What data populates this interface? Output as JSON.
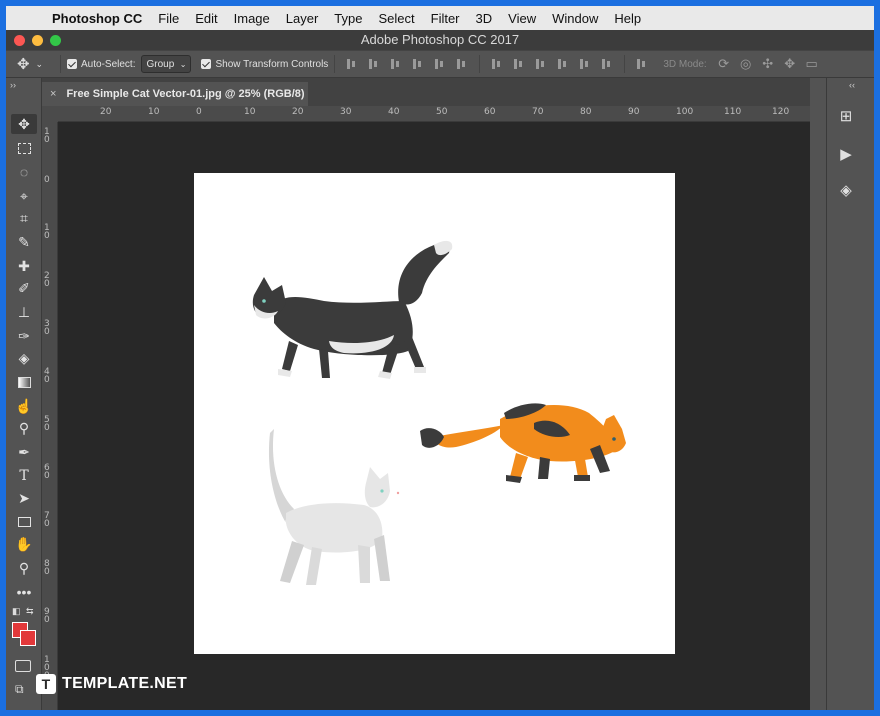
{
  "menubar": {
    "app_name": "Photoshop CC",
    "items": [
      "File",
      "Edit",
      "Image",
      "Layer",
      "Type",
      "Select",
      "Filter",
      "3D",
      "View",
      "Window",
      "Help"
    ]
  },
  "window": {
    "title": "Adobe Photoshop CC 2017"
  },
  "options": {
    "auto_select_label": "Auto-Select:",
    "auto_select_value": "Group",
    "transform_label": "Show Transform Controls",
    "mode_label": "3D Mode:"
  },
  "document": {
    "tab_title": "Free Simple Cat Vector-01.jpg @ 25% (RGB/8)",
    "close_glyph": "×"
  },
  "rulers": {
    "top": [
      "20",
      "10",
      "0",
      "10",
      "20",
      "30",
      "40",
      "50",
      "60",
      "70",
      "80",
      "90",
      "100",
      "110",
      "120"
    ],
    "left": [
      "10",
      "0",
      "10",
      "20",
      "30",
      "40",
      "50",
      "60",
      "70",
      "80",
      "90",
      "100"
    ]
  },
  "colors": {
    "foreground": "#e2383a",
    "background": "#e2383a",
    "cat_black": "#3b3b3b",
    "cat_orange": "#f28c1c",
    "cat_white": "#e3e3e3"
  },
  "watermark": {
    "logo_letter": "T",
    "text": "TEMPLATE.NET"
  },
  "icons": {
    "move": "move-icon",
    "marquee": "rect-marquee-icon",
    "lasso": "lasso-icon",
    "quick_select": "quick-select-icon",
    "crop": "crop-icon",
    "eyedropper": "eyedropper-icon",
    "healing": "healing-brush-icon",
    "brush": "brush-icon",
    "stamp": "clone-stamp-icon",
    "history_brush": "history-brush-icon",
    "eraser": "eraser-icon",
    "gradient": "gradient-icon",
    "smudge": "smudge-icon",
    "dodge": "dodge-icon",
    "pen": "pen-icon",
    "type": "type-icon",
    "path_select": "path-select-icon",
    "shape": "rectangle-shape-icon",
    "hand": "hand-icon",
    "zoom": "zoom-icon",
    "more": "more-tools-icon"
  }
}
